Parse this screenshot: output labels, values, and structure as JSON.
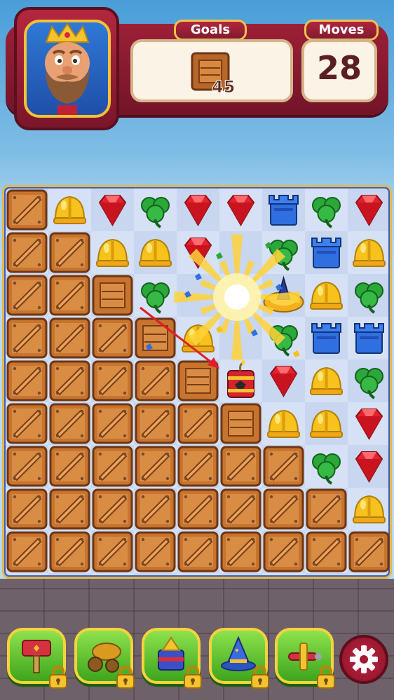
{
  "hud": {
    "goals_label": "Goals",
    "moves_label": "Moves",
    "goal_item": "wooden-crate",
    "goal_count": "45",
    "moves_count": "28"
  },
  "board": {
    "columns": 9,
    "rows": 9,
    "legend": {
      "C": "crate-diagonal",
      "S": "crate-square",
      "R": "red-gem",
      "Y": "yellow-helmet",
      "G": "green-clover",
      "B": "blue-tower",
      "T": "tnt-bomb",
      "E": "exploding-empty",
      "N": "spinning-top-booster"
    },
    "grid": [
      [
        "C",
        "Y",
        "R",
        "G",
        "R",
        "R",
        "B",
        "G",
        "R"
      ],
      [
        "C",
        "C",
        "Y",
        "Y",
        "R",
        "E",
        "G",
        "B",
        "Y"
      ],
      [
        "C",
        "C",
        "S",
        "G",
        "E",
        "E",
        "N",
        "Y",
        "G"
      ],
      [
        "C",
        "C",
        "C",
        "S",
        "Y",
        "E",
        "G",
        "B",
        "B"
      ],
      [
        "C",
        "C",
        "C",
        "C",
        "S",
        "T",
        "R",
        "Y",
        "G"
      ],
      [
        "C",
        "C",
        "C",
        "C",
        "C",
        "S",
        "Y",
        "Y",
        "R"
      ],
      [
        "C",
        "C",
        "C",
        "C",
        "C",
        "C",
        "C",
        "G",
        "R"
      ],
      [
        "C",
        "C",
        "C",
        "C",
        "C",
        "C",
        "C",
        "C",
        "Y"
      ],
      [
        "C",
        "C",
        "C",
        "C",
        "C",
        "C",
        "C",
        "C",
        "C"
      ]
    ]
  },
  "toolbar": {
    "boosters": [
      {
        "name": "hammer-booster",
        "icon": "hammer-icon",
        "locked": true
      },
      {
        "name": "cannon-booster",
        "icon": "cannon-icon",
        "locked": true
      },
      {
        "name": "arrow-booster",
        "icon": "arrow-barrel-icon",
        "locked": true
      },
      {
        "name": "wizard-hat-booster",
        "icon": "wizard-hat-icon",
        "locked": true
      },
      {
        "name": "plane-booster",
        "icon": "toy-plane-icon",
        "locked": true
      }
    ],
    "settings_icon": "gear-icon"
  },
  "colors": {
    "hud_red": "#9c2036",
    "gold_border": "#f0c24d",
    "board_tile_light": "#d6e1f5",
    "board_tile_dark": "#c8d6f0",
    "button_green": "#3da51d"
  }
}
